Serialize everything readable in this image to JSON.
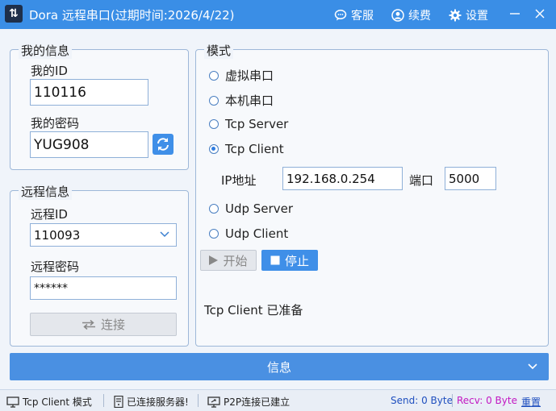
{
  "app": {
    "title": "Dora 远程串口(过期时间:2026/4/22)"
  },
  "titlebar": {
    "support_label": "客服",
    "renew_label": "续费",
    "settings_label": "设置"
  },
  "my_info": {
    "legend": "我的信息",
    "id_label": "我的ID",
    "id_value": "110116",
    "password_label": "我的密码",
    "password_value": "YUG908"
  },
  "remote_info": {
    "legend": "远程信息",
    "id_label": "远程ID",
    "id_value": "110093",
    "password_label": "远程密码",
    "password_value": "******",
    "connect_label": "连接"
  },
  "mode": {
    "legend": "模式",
    "options": [
      {
        "label": "虚拟串口",
        "selected": false
      },
      {
        "label": "本机串口",
        "selected": false
      },
      {
        "label": "Tcp Server",
        "selected": false
      },
      {
        "label": "Tcp Client",
        "selected": true
      },
      {
        "label": "Udp Server",
        "selected": false
      },
      {
        "label": "Udp Client",
        "selected": false
      }
    ],
    "ip_label": "IP地址",
    "ip_value": "192.168.0.254",
    "port_label": "端口",
    "port_value": "5000",
    "start_label": "开始",
    "stop_label": "停止",
    "status_text": "Tcp  Client 已准备"
  },
  "info_bar": {
    "label": "信息"
  },
  "statusbar": {
    "mode_text": "Tcp Client  模式",
    "server_text": "已连接服务器!",
    "p2p_text": "P2P连接已建立",
    "send_text": "Send: 0 Byte",
    "recv_text": "Recv: 0 Byte",
    "reset_label": "重置"
  },
  "colors": {
    "titlebar": "#3a8ee6",
    "accent": "#4a90e2",
    "send": "#1f4fbf",
    "recv": "#c218c2"
  }
}
